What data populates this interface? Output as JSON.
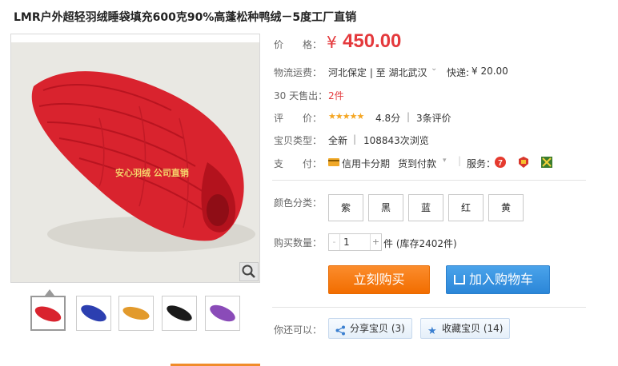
{
  "product": {
    "title": "LMR户外超轻羽绒睡袋填充600克90%高蓬松种鸭绒－5度工厂直销",
    "watermark": "安心羽绒 公司直销"
  },
  "price": {
    "label": "价　　格：",
    "currency": "¥",
    "value": "450.00"
  },
  "shipping": {
    "label": "物流运费：",
    "route": "河北保定 | 至  湖北武汉",
    "express_label": "快递:",
    "express_cost": "¥ 20.00"
  },
  "sold": {
    "label": "30 天售出：",
    "value": "2件"
  },
  "rating": {
    "label": "评　　价：",
    "stars": "★★★★★",
    "score": "4.8分",
    "reviews": "3条评价"
  },
  "condition": {
    "label": "宝贝类型：",
    "value": "全新",
    "views": "108843次浏览"
  },
  "payment": {
    "label": "支　　付：",
    "installment": "信用卡分期",
    "cod": "货到付款",
    "service_label": "服务："
  },
  "colors": {
    "label": "颜色分类：",
    "options": [
      "紫",
      "黑",
      "蓝",
      "红",
      "黄"
    ]
  },
  "quantity": {
    "label": "购买数量：",
    "minus": "-",
    "value": "1",
    "plus": "+",
    "unit_stock": "件 (库存2402件)"
  },
  "actions": {
    "buy_now": "立刻购买",
    "add_to_cart": "加入购物车"
  },
  "more": {
    "label": "你还可以：",
    "share": "分享宝贝 (3)",
    "favorite": "收藏宝贝 (14)"
  },
  "theme": {
    "price_color": "#e4393c",
    "buy_color": "#f27d0f",
    "cart_color": "#2b86d8"
  }
}
